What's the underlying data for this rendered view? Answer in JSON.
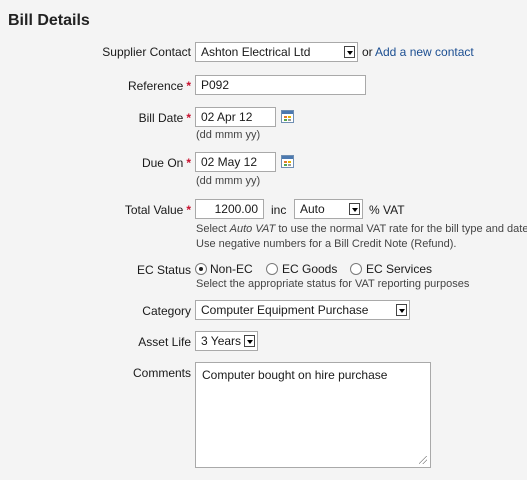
{
  "page_title": "Bill Details",
  "required_mark": "*",
  "supplier": {
    "label": "Supplier Contact",
    "value": "Ashton Electrical Ltd",
    "or_text": "or",
    "add_link": "Add a new contact"
  },
  "reference": {
    "label": "Reference",
    "value": "P092"
  },
  "bill_date": {
    "label": "Bill Date",
    "value": "02 Apr 12",
    "hint": "(dd mmm yy)"
  },
  "due_on": {
    "label": "Due On",
    "value": "02 May 12",
    "hint": "(dd mmm yy)"
  },
  "total_value": {
    "label": "Total Value",
    "value": "1200.00",
    "inc_text": "inc",
    "vat_select": "Auto",
    "vat_suffix": "% VAT",
    "hint_pre": "Select ",
    "hint_em": "Auto VAT",
    "hint_post": " to use the normal VAT rate for the bill type and date.",
    "hint_line2": "Use negative numbers for a Bill Credit Note (Refund)."
  },
  "ec_status": {
    "label": "EC Status",
    "options": [
      "Non-EC",
      "EC Goods",
      "EC Services"
    ],
    "selected": "Non-EC",
    "hint": "Select the appropriate status for VAT reporting purposes"
  },
  "category": {
    "label": "Category",
    "value": "Computer Equipment Purchase"
  },
  "asset_life": {
    "label": "Asset Life",
    "value": "3 Years"
  },
  "comments": {
    "label": "Comments",
    "value": "Computer bought on hire purchase"
  },
  "icons": {
    "calendar": "calendar-icon",
    "dropdown": "chevron-down-icon",
    "resize": "resize-grip-icon"
  },
  "colors": {
    "required": "#c8102e",
    "link": "#1b4e91"
  }
}
